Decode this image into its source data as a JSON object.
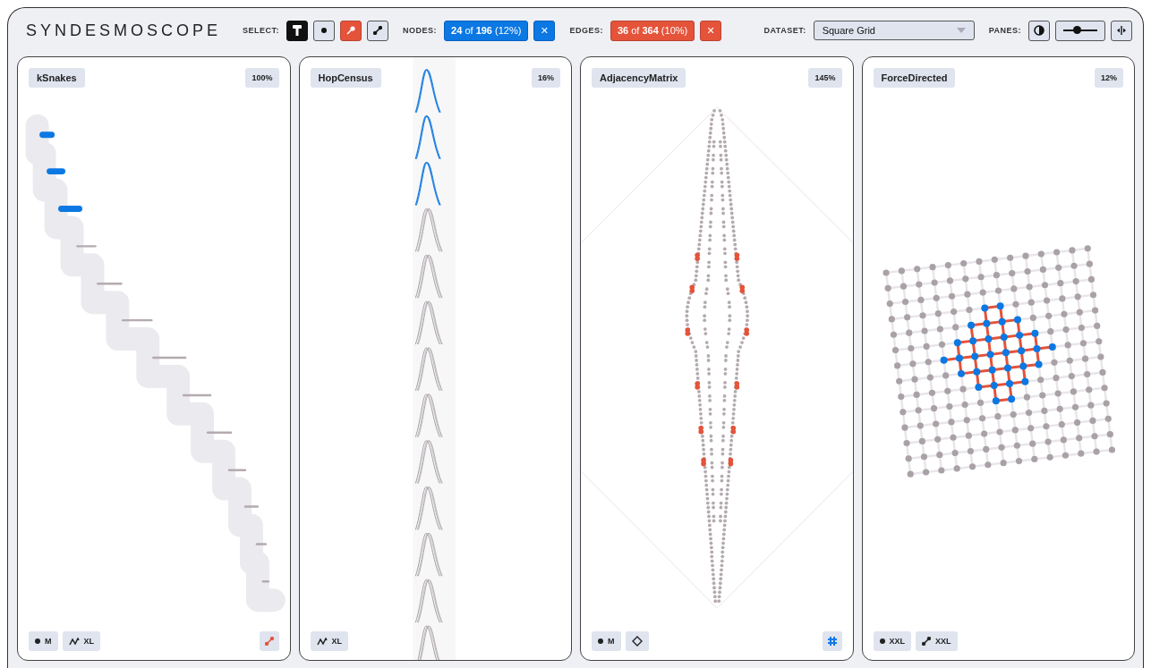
{
  "app_title": "SYNDESMOSCOPE",
  "select": {
    "label": "SELECT:",
    "tools": [
      {
        "kind": "brush",
        "selected": true,
        "highlighted": false
      },
      {
        "kind": "node",
        "selected": false,
        "highlighted": false
      },
      {
        "kind": "pin",
        "selected": false,
        "highlighted": true
      },
      {
        "kind": "edge",
        "selected": false,
        "highlighted": false
      }
    ]
  },
  "nodes": {
    "label": "NODES:",
    "count": "**24** of **196** (12%)",
    "clear": "✕"
  },
  "edges": {
    "label": "EDGES:",
    "count": "**36** of **364** (10%)",
    "clear": "✕"
  },
  "dataset": {
    "label": "DATASET:",
    "value": "Square Grid"
  },
  "panes": {
    "label": "PANES:",
    "level": 0.4
  },
  "panels": [
    {
      "kind": "snakes",
      "title": "kSnakes",
      "zoom": "100%",
      "footer_left": [
        {
          "kind": "dot",
          "label": "M"
        },
        {
          "kind": "wave",
          "label": "XL"
        }
      ],
      "footer_right": [
        {
          "kind": "edge",
          "color": "#e4533a"
        }
      ]
    },
    {
      "kind": "hopcensus",
      "title": "HopCensus",
      "zoom": "16%",
      "footer_left": [
        {
          "kind": "wave",
          "label": "XL"
        }
      ]
    },
    {
      "kind": "matrix",
      "title": "AdjacencyMatrix",
      "zoom": "145%",
      "footer_left": [
        {
          "kind": "dot",
          "label": "M"
        },
        {
          "kind": "diamond"
        }
      ],
      "footer_right": [
        {
          "kind": "grid",
          "color": "#1479e6"
        }
      ]
    },
    {
      "kind": "force",
      "title": "ForceDirected",
      "zoom": "12%",
      "footer_left": [
        {
          "kind": "dot",
          "label": "XXL"
        },
        {
          "kind": "edge",
          "label": "XXL"
        }
      ]
    }
  ]
}
